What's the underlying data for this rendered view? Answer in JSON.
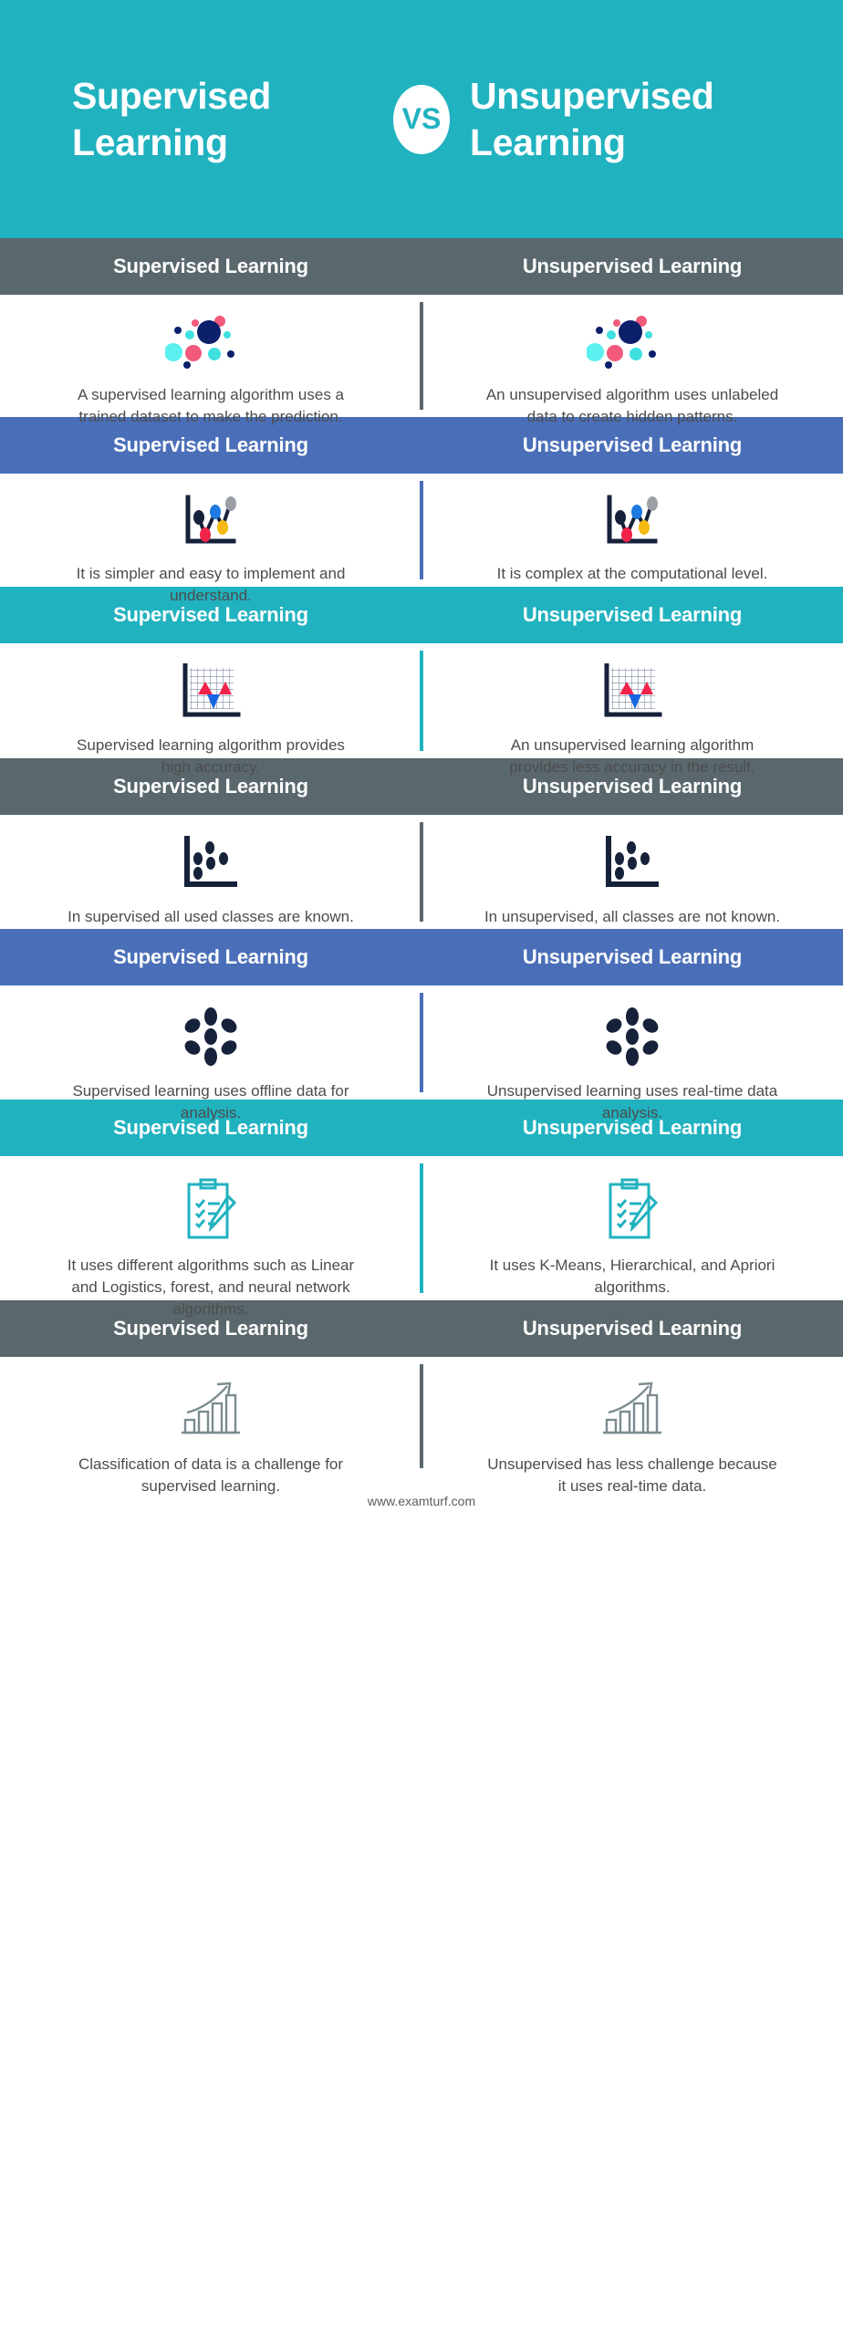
{
  "title": {
    "left": "Supervised Learning",
    "vs": "VS",
    "right": "Unsupervised Learning"
  },
  "colors": {
    "teal": "#21b2c0",
    "blue": "#4a6fb8",
    "gray": "#5a686d",
    "white": "#ffffff",
    "body_text": "#4c4c4c"
  },
  "column_headers": {
    "left": "Supervised Learning",
    "right": "Unsupervised Learning"
  },
  "sections": [
    {
      "bar_color": "gray",
      "left_header": "Supervised Learning",
      "right_header": "Unsupervised Learning",
      "icon": "scatter-dots-icon",
      "left_text": "A supervised learning algorithm uses a trained dataset to make the prediction.",
      "right_text": "An unsupervised algorithm uses unlabeled data to create hidden patterns."
    },
    {
      "bar_color": "blue",
      "left_header": "Supervised Learning",
      "right_header": "Unsupervised Learning",
      "icon": "line-graph-nodes-icon",
      "left_text": "It is simpler and easy to implement and understand.",
      "right_text": "It is complex at the computational level."
    },
    {
      "bar_color": "teal",
      "left_header": "Supervised Learning",
      "right_header": "Unsupervised Learning",
      "icon": "grid-triangles-chart-icon",
      "left_text": "Supervised learning algorithm provides high accuracy.",
      "right_text": "An unsupervised learning algorithm provides less accuracy in the result."
    },
    {
      "bar_color": "gray",
      "left_header": "Supervised Learning",
      "right_header": "Unsupervised Learning",
      "icon": "scatter-plot-axes-icon",
      "left_text": "In supervised all used classes are known.",
      "right_text": "In unsupervised, all classes are not known."
    },
    {
      "bar_color": "blue",
      "left_header": "Supervised Learning",
      "right_header": "Unsupervised Learning",
      "icon": "cluster-flower-icon",
      "left_text": "Supervised learning uses offline data for analysis.",
      "right_text": "Unsupervised learning uses real-time data analysis."
    },
    {
      "bar_color": "teal",
      "left_header": "Supervised Learning",
      "right_header": "Unsupervised Learning",
      "icon": "clipboard-checklist-pencil-icon",
      "left_text": "It uses different algorithms such as Linear and Logistics, forest, and neural network algorithms.",
      "right_text": "It uses K-Means, Hierarchical, and Apriori algorithms."
    },
    {
      "bar_color": "gray",
      "left_header": "Supervised Learning",
      "right_header": "Unsupervised Learning",
      "icon": "growth-bar-chart-arrow-icon",
      "left_text": "Classification of data is a challenge for supervised learning.",
      "right_text": "Unsupervised has less challenge because it uses real-time data."
    }
  ],
  "footer": {
    "url": "www.examturf.com"
  }
}
